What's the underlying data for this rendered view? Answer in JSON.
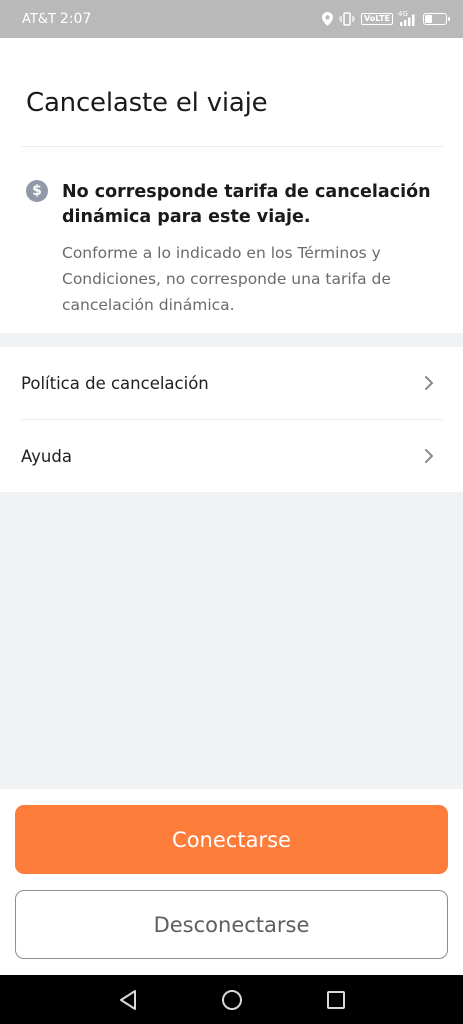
{
  "status_bar": {
    "carrier": "AT&T",
    "time": "2:07",
    "volte": "VoLTE",
    "network": "4G",
    "icons": [
      "location-icon",
      "vibrate-icon",
      "volte-icon",
      "signal-icon",
      "battery-icon"
    ]
  },
  "header": {
    "title": "Cancelaste el viaje"
  },
  "notice": {
    "icon": "dollar-icon",
    "title": "No corresponde tarifa de cancelación dinámica para este viaje.",
    "body": "Conforme a lo indicado en los Términos y Condiciones, no corresponde una tarifa de cancelación dinámica."
  },
  "menu": {
    "items": [
      {
        "label": "Política de cancelación",
        "icon": "chevron-right-icon"
      },
      {
        "label": "Ayuda",
        "icon": "chevron-right-icon"
      }
    ]
  },
  "actions": {
    "connect_label": "Conectarse",
    "disconnect_label": "Desconectarse"
  },
  "nav": {
    "icons": [
      "back-icon",
      "home-icon",
      "recents-icon"
    ]
  },
  "colors": {
    "accent": "#ff7d3b",
    "status_bar": "#b9b9b9",
    "background": "#f1f2f4",
    "icon_gray": "#9099a7"
  }
}
